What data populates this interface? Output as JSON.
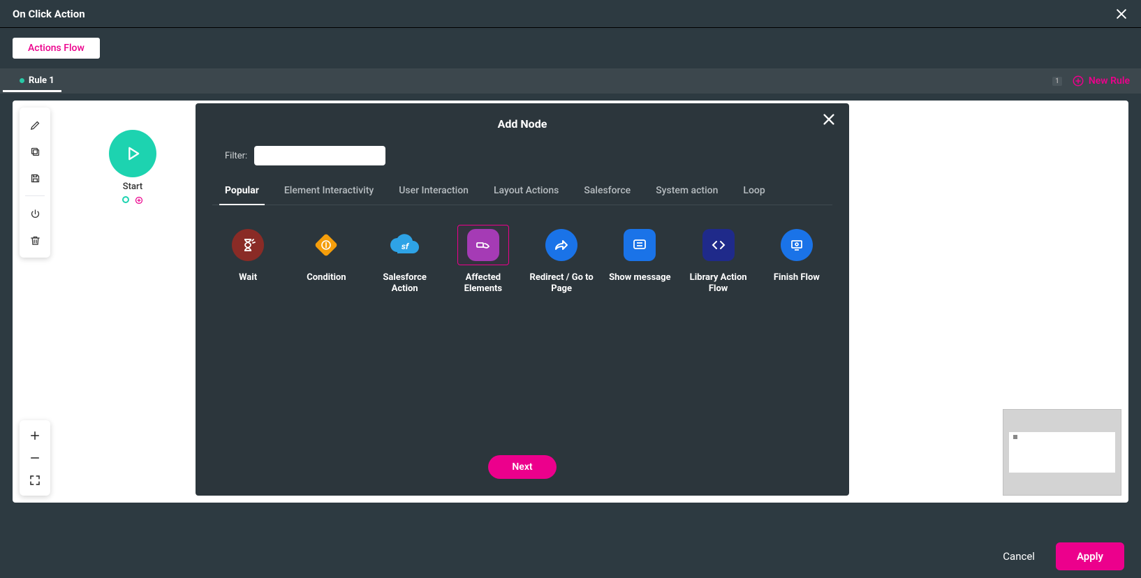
{
  "header": {
    "title": "On Click Action"
  },
  "subheader": {
    "actions_flow_label": "Actions Flow"
  },
  "rulebar": {
    "rule_label": "Rule 1",
    "count": "1",
    "new_rule_label": "New Rule"
  },
  "start_node": {
    "label": "Start"
  },
  "modal": {
    "title": "Add Node",
    "filter_label": "Filter:",
    "filter_value": "",
    "tabs": [
      {
        "label": "Popular"
      },
      {
        "label": "Element Interactivity"
      },
      {
        "label": "User Interaction"
      },
      {
        "label": "Layout Actions"
      },
      {
        "label": "Salesforce"
      },
      {
        "label": "System action"
      },
      {
        "label": "Loop"
      }
    ],
    "nodes": [
      {
        "label": "Wait",
        "color": "#8a2b26",
        "shape": "circle",
        "icon": "hourglass"
      },
      {
        "label": "Condition",
        "color": "#f59e0b",
        "shape": "diamond",
        "icon": "condition"
      },
      {
        "label": "Salesforce Action",
        "color": "#2ea3e6",
        "shape": "cloud",
        "icon": "sf"
      },
      {
        "label": "Affected Elements",
        "color": "#a53bb5",
        "shape": "round",
        "icon": "hand"
      },
      {
        "label": "Redirect / Go to Page",
        "color": "#1a73e8",
        "shape": "circle",
        "icon": "share"
      },
      {
        "label": "Show message",
        "color": "#1a73e8",
        "shape": "round",
        "icon": "message"
      },
      {
        "label": "Library Action Flow",
        "color": "#1f2a8a",
        "shape": "round",
        "icon": "code"
      },
      {
        "label": "Finish Flow",
        "color": "#1a73e8",
        "shape": "circle",
        "icon": "finish"
      }
    ],
    "next_label": "Next"
  },
  "footer": {
    "cancel_label": "Cancel",
    "apply_label": "Apply"
  }
}
